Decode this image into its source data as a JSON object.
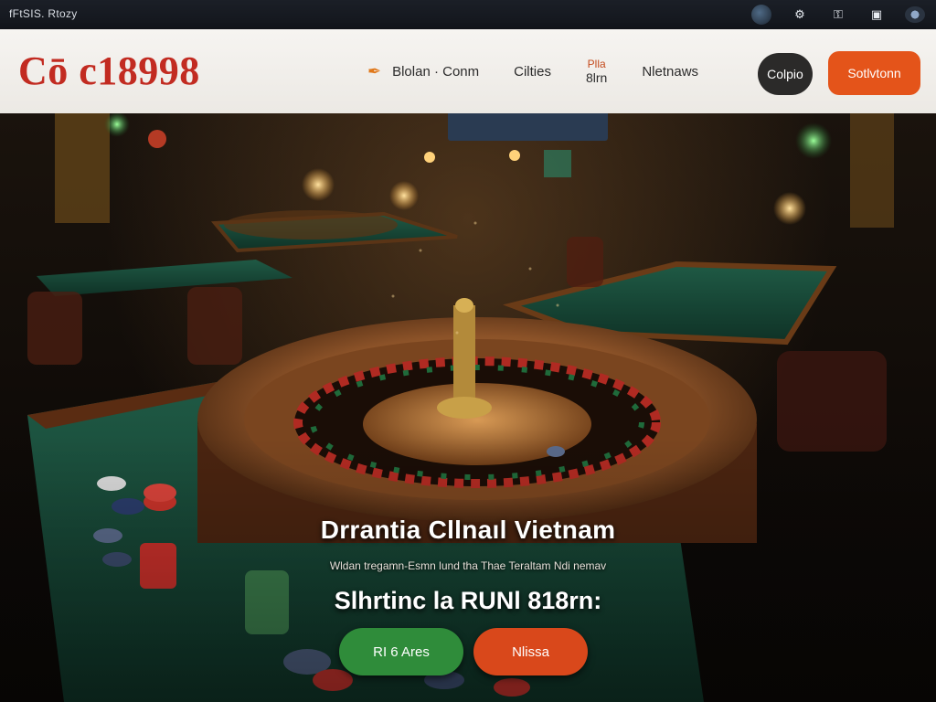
{
  "system_bar": {
    "title": "fFtSIS. Rtozy",
    "icons": [
      "avatar-icon",
      "tools-icon",
      "key-icon",
      "window-icon",
      "globe-icon"
    ]
  },
  "header": {
    "logo": "Cō c18998",
    "nav": [
      {
        "icon": "bulb-icon",
        "label": "Blolan · Conm"
      },
      {
        "label": "Cilties"
      },
      {
        "label_top": "Plla",
        "label_bottom": "8lrn"
      },
      {
        "label": "Nletnaws"
      }
    ],
    "dark_button": "Colpio",
    "orange_button": "Sotlvtonn"
  },
  "hero": {
    "title": "Drrantia Cllnaıl Vietnam",
    "subtitle": "Wldan tregamn-Esmn lund tha Thae Teraltam Ndi nemav",
    "headline": "Slhrtinc la RUNl 818rn:",
    "cta_primary": "RI 6 Ares",
    "cta_secondary": "Nlissa"
  },
  "colors": {
    "brand_red": "#c22b21",
    "accent_orange": "#e4541a",
    "cta_green": "#2f8c3a",
    "cta_red": "#d9481b",
    "dark_button": "#2b2a29"
  }
}
